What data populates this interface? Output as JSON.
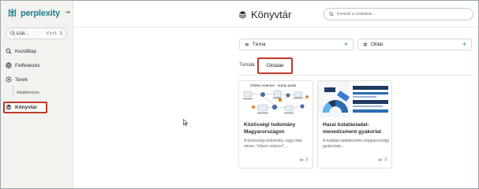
{
  "app": {
    "brand": "perplexity",
    "brand_color": "#20808d"
  },
  "sidebar": {
    "new_thread_label": "Új szál...",
    "new_thread_shortcut": "Ctrl I",
    "items": [
      {
        "label": "Kezdőlap",
        "icon": "search-icon"
      },
      {
        "label": "Felfedezés",
        "icon": "globe-icon"
      },
      {
        "label": "Terek",
        "icon": "spaces-icon"
      },
      {
        "label": "Könyvtár",
        "icon": "library-icon",
        "active": true
      }
    ],
    "sub_item": "Adatelemzés"
  },
  "header": {
    "title": "Könyvtár",
    "search_placeholder": "Keresd a szálakat..."
  },
  "filters": [
    {
      "label": "Téma",
      "icon": "topic-icon"
    },
    {
      "label": "Oldal",
      "icon": "sparkle-icon"
    }
  ],
  "tabs": [
    {
      "label": "Témák",
      "active": false
    },
    {
      "label": "Oldalak",
      "active": true
    }
  ],
  "cards": [
    {
      "thumb_caption": "Citizen science - some possi",
      "title": "Közösségi tudomány Magyarországon",
      "desc": "A közösségi tudomány, vagy más néven \"citizen science\",...",
      "views": "3"
    },
    {
      "title": "Hazai kutatásiadat-menedzsment gyakorlat",
      "desc": "A kutatási adatkezelés magyarországi gyakorlata...",
      "views": "3"
    }
  ]
}
